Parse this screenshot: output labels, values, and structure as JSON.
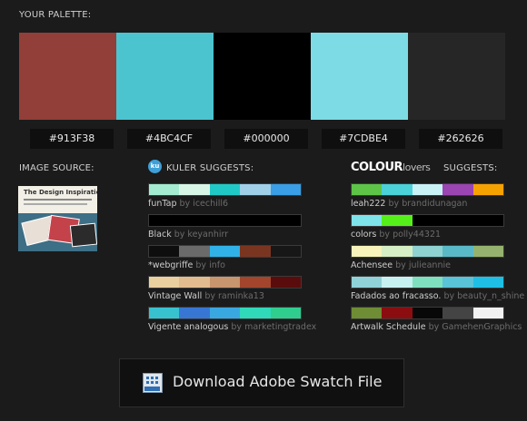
{
  "palette": {
    "heading": "YOUR PALETTE:",
    "swatches": [
      {
        "hex": "#913F38",
        "color": "#913f38"
      },
      {
        "hex": "#4BC4CF",
        "color": "#4bc4cf"
      },
      {
        "hex": "#000000",
        "color": "#000000"
      },
      {
        "hex": "#7CDBE4",
        "color": "#7cdbe4"
      },
      {
        "hex": "#262626",
        "color": "#262626"
      }
    ]
  },
  "image_source": {
    "heading": "IMAGE SOURCE:",
    "thumb_title": "The Design Inspiration"
  },
  "kuler": {
    "logo_text": "ku",
    "heading": "KULER SUGGESTS:",
    "themes": [
      {
        "name": "funTap",
        "by": "by",
        "author": "icechill6",
        "colors": [
          "#a3ecd2",
          "#d8f6e6",
          "#21c9c6",
          "#9fd0e8",
          "#3a9fe6"
        ]
      },
      {
        "name": "Black",
        "by": "by",
        "author": "keyanhirr",
        "colors": [
          "#000000",
          "#000000",
          "#000000",
          "#000000",
          "#000000"
        ]
      },
      {
        "name": "*webgriffe",
        "by": "by",
        "author": "info",
        "colors": [
          "#0e0e0e",
          "#6a6a6a",
          "#30b2e8",
          "#7a3521",
          "#171717"
        ]
      },
      {
        "name": "Vintage Wall",
        "by": "by",
        "author": "raminka13",
        "colors": [
          "#ead09f",
          "#e2bc8f",
          "#c7956e",
          "#a2452c",
          "#5a0c0c"
        ]
      },
      {
        "name": "Vigente analogous",
        "by": "by",
        "author": "marketingtradex",
        "colors": [
          "#38c2cf",
          "#3777d3",
          "#3aa8e0",
          "#2fd9b9",
          "#2fce8f"
        ]
      }
    ]
  },
  "colourlovers": {
    "logo_bold": "COLOUR",
    "logo_light": "lovers",
    "heading": "SUGGESTS:",
    "palettes": [
      {
        "name": "leah222",
        "by": "by",
        "author": "brandidunagan",
        "colors": [
          "#5ec448",
          "#4bd1d8",
          "#c9f2f6",
          "#9b45b2",
          "#f6a200"
        ]
      },
      {
        "name": "colors",
        "by": "by",
        "author": "polly44321",
        "colors": [
          "#7ee4ea",
          "#55f019",
          "#000000",
          "#000000",
          "#000000"
        ]
      },
      {
        "name": "Achensee",
        "by": "by",
        "author": "julieannie",
        "colors": [
          "#f7f3ba",
          "#d6efc4",
          "#8ed2d2",
          "#5ab9c7",
          "#95b36e"
        ]
      },
      {
        "name": "Fadados ao fracasso.",
        "by": "by",
        "author": "beauty_n_shine",
        "colors": [
          "#90d2d8",
          "#c7f0f0",
          "#7fe0c0",
          "#59c3d8",
          "#1fbfe5"
        ]
      },
      {
        "name": "Artwalk Schedule",
        "by": "by",
        "author": "GamehenGraphics",
        "colors": [
          "#6e8d34",
          "#8c0d10",
          "#080808",
          "#444444",
          "#f2f2f2"
        ]
      }
    ]
  },
  "download": {
    "label": "Download Adobe Swatch File",
    "icon": "adobe-swatch-file-icon"
  }
}
